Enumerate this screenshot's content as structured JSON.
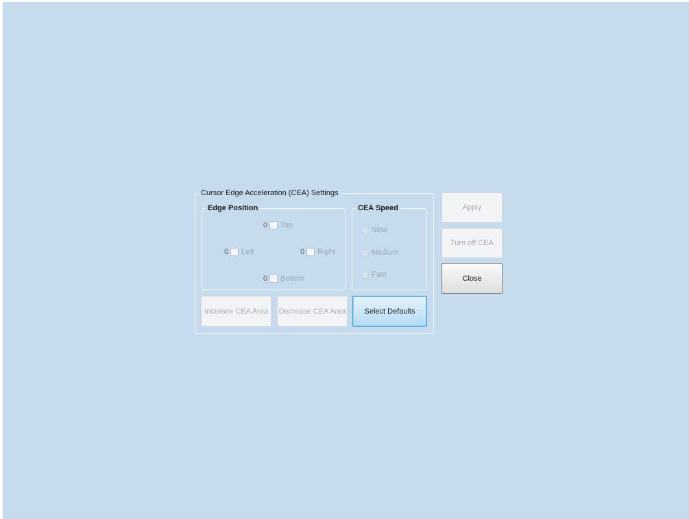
{
  "dialog": {
    "title": "Cursor Edge Acceleration (CEA) Settings"
  },
  "edge_position": {
    "title": "Edge Position",
    "top": {
      "value": "0",
      "label": "Top"
    },
    "left": {
      "value": "0",
      "label": "Left"
    },
    "right": {
      "value": "0",
      "label": "Right"
    },
    "bottom": {
      "value": "0",
      "label": "Bottom"
    }
  },
  "cea_speed": {
    "title": "CEA Speed",
    "options": [
      "Slow",
      "Medium",
      "Fast"
    ]
  },
  "buttons": {
    "increase": "Increase CEA Area",
    "decrease": "Decrease CEA Area",
    "select_defaults": "Select Defaults",
    "apply": "Apply",
    "turn_off": "Turn off CEA",
    "close": "Close"
  }
}
